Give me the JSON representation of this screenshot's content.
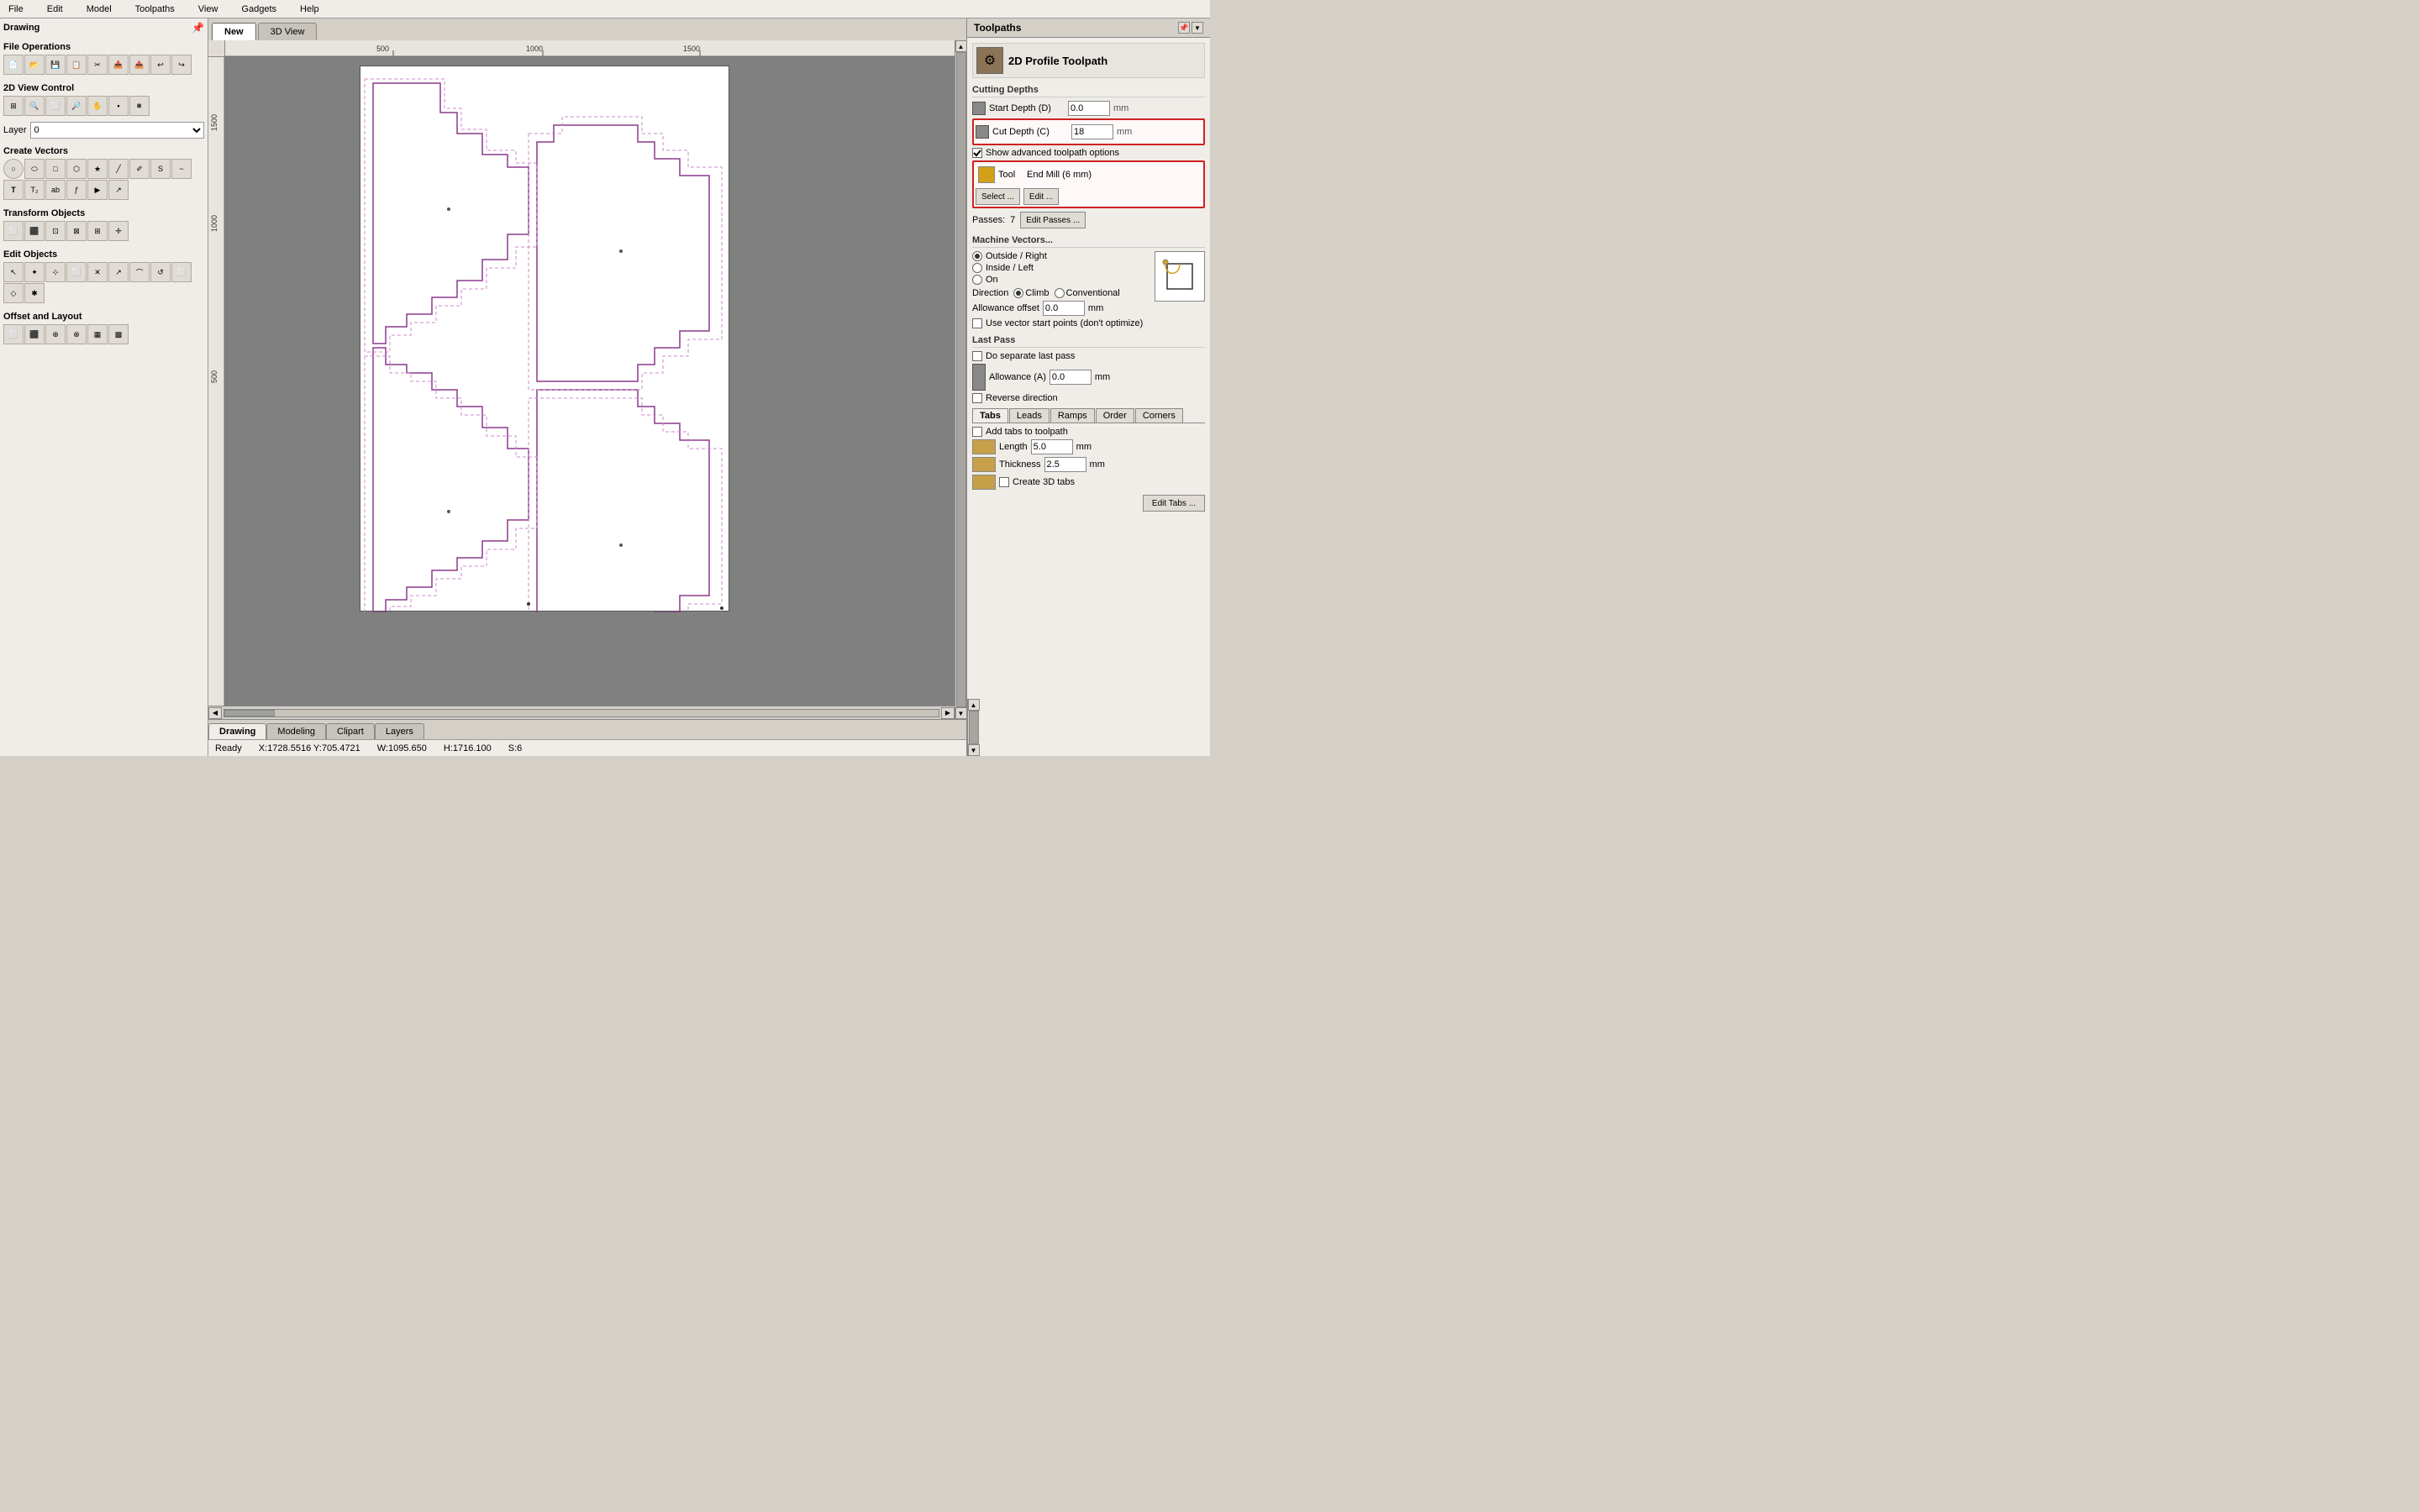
{
  "app": {
    "title": "Drawing",
    "status": "Ready"
  },
  "menubar": {
    "items": [
      "File",
      "Edit",
      "Model",
      "Toolpaths",
      "View",
      "Gadgets",
      "Help"
    ]
  },
  "tabs": {
    "items": [
      "New",
      "3D View"
    ],
    "active": "New"
  },
  "bottom_tabs": {
    "items": [
      "Drawing",
      "Modeling",
      "Clipart",
      "Layers"
    ],
    "active": "Drawing"
  },
  "left_panel": {
    "sections": [
      {
        "title": "File Operations",
        "tools": [
          "📄",
          "📁",
          "💾",
          "📋",
          "✂️",
          "📊",
          "🔄",
          "↩",
          "↪"
        ]
      },
      {
        "title": "2D View Control",
        "tools": [
          "🔄",
          "🔍",
          "⬜",
          "🔍",
          "◻",
          "▪",
          "◾"
        ]
      },
      {
        "title": "Layer",
        "layer_value": "0"
      },
      {
        "title": "Create Vectors",
        "tools": [
          "○",
          "⬭",
          "□",
          "⬡",
          "★",
          "╱",
          "✂",
          "S",
          "~",
          "T",
          "T2",
          "ab",
          "𝑓",
          "▶",
          "↗"
        ]
      },
      {
        "title": "Transform Objects",
        "tools": [
          "⬜",
          "⬛",
          "⊡",
          "⊠",
          "⊞",
          "✛"
        ]
      },
      {
        "title": "Edit Objects",
        "tools": [
          "↖",
          "✦",
          "⊹",
          "⬜",
          "✕",
          "↗",
          "⌒",
          "↺",
          "⬜",
          "◇",
          "✱"
        ]
      },
      {
        "title": "Offset and Layout",
        "tools": [
          "⬜",
          "⬛",
          "⊕",
          "⊗",
          "▦",
          "▩"
        ]
      }
    ]
  },
  "right_panel": {
    "header": "Toolpaths",
    "toolpath_title": "2D Profile Toolpath",
    "cutting_depths": {
      "label": "Cutting Depths",
      "start_depth_label": "Start Depth (D)",
      "start_depth_value": "0.0",
      "cut_depth_label": "Cut Depth (C)",
      "cut_depth_value": "18",
      "unit": "mm",
      "show_advanced_checked": true,
      "show_advanced_label": "Show advanced toolpath options"
    },
    "tool": {
      "label": "Tool",
      "value": "End Mill (6 mm)",
      "select_label": "Select ...",
      "edit_label": "Edit ..."
    },
    "passes": {
      "label": "Passes:",
      "value": "7",
      "edit_label": "Edit Passes ..."
    },
    "machine_vectors": {
      "label": "Machine Vectors...",
      "options": [
        "Outside / Right",
        "Inside / Left",
        "On"
      ],
      "selected": "Outside / Right",
      "direction_label": "Direction",
      "direction_options": [
        "Climb",
        "Conventional"
      ],
      "direction_selected": "Climb",
      "allowance_label": "Allowance offset",
      "allowance_value": "0.0",
      "allowance_unit": "mm",
      "use_vector_start_label": "Use vector start points (don't optimize)"
    },
    "last_pass": {
      "label": "Last Pass",
      "do_separate_label": "Do separate last pass",
      "allowance_label": "Allowance (A)",
      "allowance_value": "0.0",
      "allowance_unit": "mm",
      "reverse_direction_label": "Reverse direction"
    },
    "sub_tabs": [
      "Tabs",
      "Leads",
      "Ramps",
      "Order",
      "Corners"
    ],
    "active_sub_tab": "Tabs",
    "tabs_section": {
      "add_tabs_label": "Add tabs to toolpath",
      "length_label": "Length",
      "length_value": "5.0",
      "length_unit": "mm",
      "thickness_label": "Thickness",
      "thickness_value": "2.5",
      "thickness_unit": "mm",
      "create_3d_label": "Create 3D tabs",
      "edit_tabs_label": "Edit Tabs ..."
    }
  },
  "statusbar": {
    "ready": "Ready",
    "coords": "X:1728.5516 Y:705.4721",
    "w": "W:1095.650",
    "h": "H:1716.100",
    "s": "S:6"
  },
  "canvas": {
    "ruler_marks_h": [
      "500",
      "1000",
      "1500"
    ],
    "ruler_marks_v": [
      "1500",
      "1000",
      "500"
    ]
  }
}
